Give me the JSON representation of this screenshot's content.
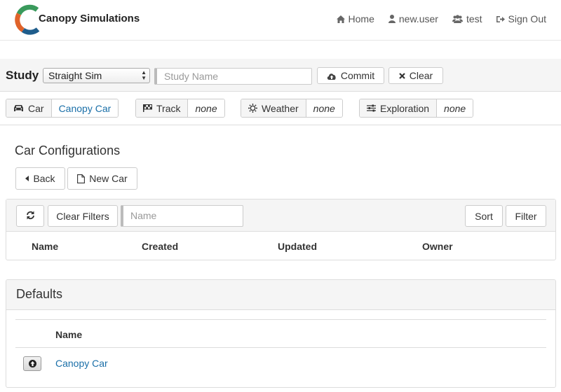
{
  "header": {
    "brand": "Canopy Simulations",
    "nav": [
      {
        "label": "Home",
        "icon": "home-icon"
      },
      {
        "label": "new.user",
        "icon": "user-icon"
      },
      {
        "label": "test",
        "icon": "users-icon"
      },
      {
        "label": "Sign Out",
        "icon": "sign-out-icon"
      }
    ],
    "logo_colors": [
      "#2e8b57",
      "#e0632a",
      "#1f5d8c"
    ]
  },
  "study": {
    "label": "Study",
    "selected_type": "Straight Sim",
    "name_placeholder": "Study Name",
    "commit_label": "Commit",
    "clear_label": "Clear"
  },
  "config": {
    "car": {
      "label": "Car",
      "value": "Canopy Car"
    },
    "track": {
      "label": "Track",
      "value": "none"
    },
    "weather": {
      "label": "Weather",
      "value": "none"
    },
    "exploration": {
      "label": "Exploration",
      "value": "none"
    }
  },
  "car_configs": {
    "title": "Car Configurations",
    "back_label": "Back",
    "new_car_label": "New Car",
    "clear_filters_label": "Clear Filters",
    "filter_placeholder": "Name",
    "sort_label": "Sort",
    "filter_label": "Filter",
    "columns": [
      "Name",
      "Created",
      "Updated",
      "Owner"
    ]
  },
  "defaults": {
    "title": "Defaults",
    "column": "Name",
    "rows": [
      {
        "name": "Canopy Car"
      }
    ]
  },
  "colors": {
    "link": "#1a6fa8",
    "panel_bg": "#f5f5f5",
    "border": "#dddddd"
  }
}
